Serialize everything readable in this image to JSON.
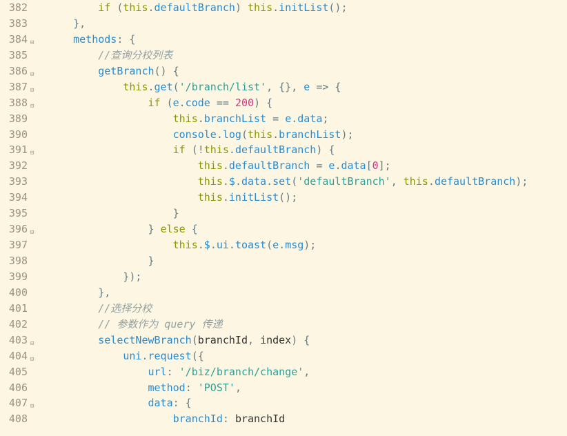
{
  "lines": [
    {
      "n": "382",
      "fold": "",
      "code": [
        [
          "        "
        ],
        [
          "kw",
          "if"
        ],
        [
          " ("
        ],
        [
          "kw",
          "this"
        ],
        [
          "op",
          "."
        ],
        [
          "prop",
          "defaultBranch"
        ],
        [
          ") "
        ],
        [
          "kw",
          "this"
        ],
        [
          "op",
          "."
        ],
        [
          "prop",
          "initList"
        ],
        [
          "();"
        ]
      ]
    },
    {
      "n": "383",
      "fold": "",
      "code": [
        [
          "    },"
        ]
      ]
    },
    {
      "n": "384",
      "fold": "⊟",
      "code": [
        [
          "    "
        ],
        [
          "prop",
          "methods"
        ],
        [
          ": {"
        ]
      ]
    },
    {
      "n": "385",
      "fold": "",
      "code": [
        [
          "        "
        ],
        [
          "cmt",
          "//查询分校列表"
        ]
      ]
    },
    {
      "n": "386",
      "fold": "⊟",
      "code": [
        [
          "        "
        ],
        [
          "prop",
          "getBranch"
        ],
        [
          "() {"
        ]
      ]
    },
    {
      "n": "387",
      "fold": "⊟",
      "code": [
        [
          "            "
        ],
        [
          "kw",
          "this"
        ],
        [
          "op",
          "."
        ],
        [
          "prop",
          "get"
        ],
        [
          "("
        ],
        [
          "str",
          "'/branch/list'"
        ],
        [
          ", {}, "
        ],
        [
          "prop",
          "e"
        ],
        [
          " => {"
        ]
      ]
    },
    {
      "n": "388",
      "fold": "⊟",
      "code": [
        [
          "                "
        ],
        [
          "kw",
          "if"
        ],
        [
          " ("
        ],
        [
          "prop",
          "e"
        ],
        [
          "op",
          "."
        ],
        [
          "prop",
          "code"
        ],
        [
          " == "
        ],
        [
          "num",
          "200"
        ],
        [
          ") {"
        ]
      ]
    },
    {
      "n": "389",
      "fold": "",
      "code": [
        [
          "                    "
        ],
        [
          "kw",
          "this"
        ],
        [
          "op",
          "."
        ],
        [
          "prop",
          "branchList"
        ],
        [
          " = "
        ],
        [
          "prop",
          "e"
        ],
        [
          "op",
          "."
        ],
        [
          "prop",
          "data"
        ],
        [
          ";"
        ]
      ]
    },
    {
      "n": "390",
      "fold": "",
      "code": [
        [
          "                    "
        ],
        [
          "prop",
          "console"
        ],
        [
          "op",
          "."
        ],
        [
          "prop",
          "log"
        ],
        [
          "("
        ],
        [
          "kw",
          "this"
        ],
        [
          "op",
          "."
        ],
        [
          "prop",
          "branchList"
        ],
        [
          ");"
        ]
      ]
    },
    {
      "n": "391",
      "fold": "⊟",
      "code": [
        [
          "                    "
        ],
        [
          "kw",
          "if"
        ],
        [
          " (!"
        ],
        [
          "kw",
          "this"
        ],
        [
          "op",
          "."
        ],
        [
          "prop",
          "defaultBranch"
        ],
        [
          ") {"
        ]
      ]
    },
    {
      "n": "392",
      "fold": "",
      "code": [
        [
          "                        "
        ],
        [
          "kw",
          "this"
        ],
        [
          "op",
          "."
        ],
        [
          "prop",
          "defaultBranch"
        ],
        [
          " = "
        ],
        [
          "prop",
          "e"
        ],
        [
          "op",
          "."
        ],
        [
          "prop",
          "data"
        ],
        [
          "["
        ],
        [
          "num",
          "0"
        ],
        [
          "];"
        ]
      ]
    },
    {
      "n": "393",
      "fold": "",
      "code": [
        [
          "                        "
        ],
        [
          "kw",
          "this"
        ],
        [
          "op",
          "."
        ],
        [
          "prop",
          "$"
        ],
        [
          "op",
          "."
        ],
        [
          "prop",
          "data"
        ],
        [
          "op",
          "."
        ],
        [
          "prop",
          "set"
        ],
        [
          "("
        ],
        [
          "str",
          "'defaultBranch'"
        ],
        [
          ", "
        ],
        [
          "kw",
          "this"
        ],
        [
          "op",
          "."
        ],
        [
          "prop",
          "defaultBranch"
        ],
        [
          ");"
        ]
      ]
    },
    {
      "n": "394",
      "fold": "",
      "code": [
        [
          "                        "
        ],
        [
          "kw",
          "this"
        ],
        [
          "op",
          "."
        ],
        [
          "prop",
          "initList"
        ],
        [
          "();"
        ]
      ]
    },
    {
      "n": "395",
      "fold": "",
      "code": [
        [
          "                    }"
        ]
      ]
    },
    {
      "n": "396",
      "fold": "⊟",
      "code": [
        [
          "                } "
        ],
        [
          "kw",
          "else"
        ],
        [
          " {"
        ]
      ]
    },
    {
      "n": "397",
      "fold": "",
      "code": [
        [
          "                    "
        ],
        [
          "kw",
          "this"
        ],
        [
          "op",
          "."
        ],
        [
          "prop",
          "$"
        ],
        [
          "op",
          "."
        ],
        [
          "prop",
          "ui"
        ],
        [
          "op",
          "."
        ],
        [
          "prop",
          "toast"
        ],
        [
          "("
        ],
        [
          "prop",
          "e"
        ],
        [
          "op",
          "."
        ],
        [
          "prop",
          "msg"
        ],
        [
          ");"
        ]
      ]
    },
    {
      "n": "398",
      "fold": "",
      "code": [
        [
          "                }"
        ]
      ]
    },
    {
      "n": "399",
      "fold": "",
      "code": [
        [
          "            });"
        ]
      ]
    },
    {
      "n": "400",
      "fold": "",
      "code": [
        [
          "        },"
        ]
      ]
    },
    {
      "n": "401",
      "fold": "",
      "code": [
        [
          "        "
        ],
        [
          "cmt",
          "//选择分校"
        ]
      ]
    },
    {
      "n": "402",
      "fold": "",
      "code": [
        [
          "        "
        ],
        [
          "cmt",
          "// 参数作为 query 传递"
        ]
      ]
    },
    {
      "n": "403",
      "fold": "⊟",
      "code": [
        [
          "        "
        ],
        [
          "prop",
          "selectNewBranch"
        ],
        [
          "("
        ],
        [
          "ident",
          "branchId"
        ],
        [
          ", "
        ],
        [
          "ident",
          "index"
        ],
        [
          ") {"
        ]
      ]
    },
    {
      "n": "404",
      "fold": "⊟",
      "code": [
        [
          "            "
        ],
        [
          "prop",
          "uni"
        ],
        [
          "op",
          "."
        ],
        [
          "prop",
          "request"
        ],
        [
          "({"
        ]
      ]
    },
    {
      "n": "405",
      "fold": "",
      "code": [
        [
          "                "
        ],
        [
          "prop",
          "url"
        ],
        [
          ": "
        ],
        [
          "str",
          "'/biz/branch/change'"
        ],
        [
          ","
        ]
      ]
    },
    {
      "n": "406",
      "fold": "",
      "code": [
        [
          "                "
        ],
        [
          "prop",
          "method"
        ],
        [
          ": "
        ],
        [
          "str",
          "'POST'"
        ],
        [
          ","
        ]
      ]
    },
    {
      "n": "407",
      "fold": "⊟",
      "code": [
        [
          "                "
        ],
        [
          "prop",
          "data"
        ],
        [
          ": {"
        ]
      ]
    },
    {
      "n": "408",
      "fold": "",
      "code": [
        [
          "                    "
        ],
        [
          "prop",
          "branchId"
        ],
        [
          ": "
        ],
        [
          "ident",
          "branchId"
        ]
      ]
    }
  ]
}
